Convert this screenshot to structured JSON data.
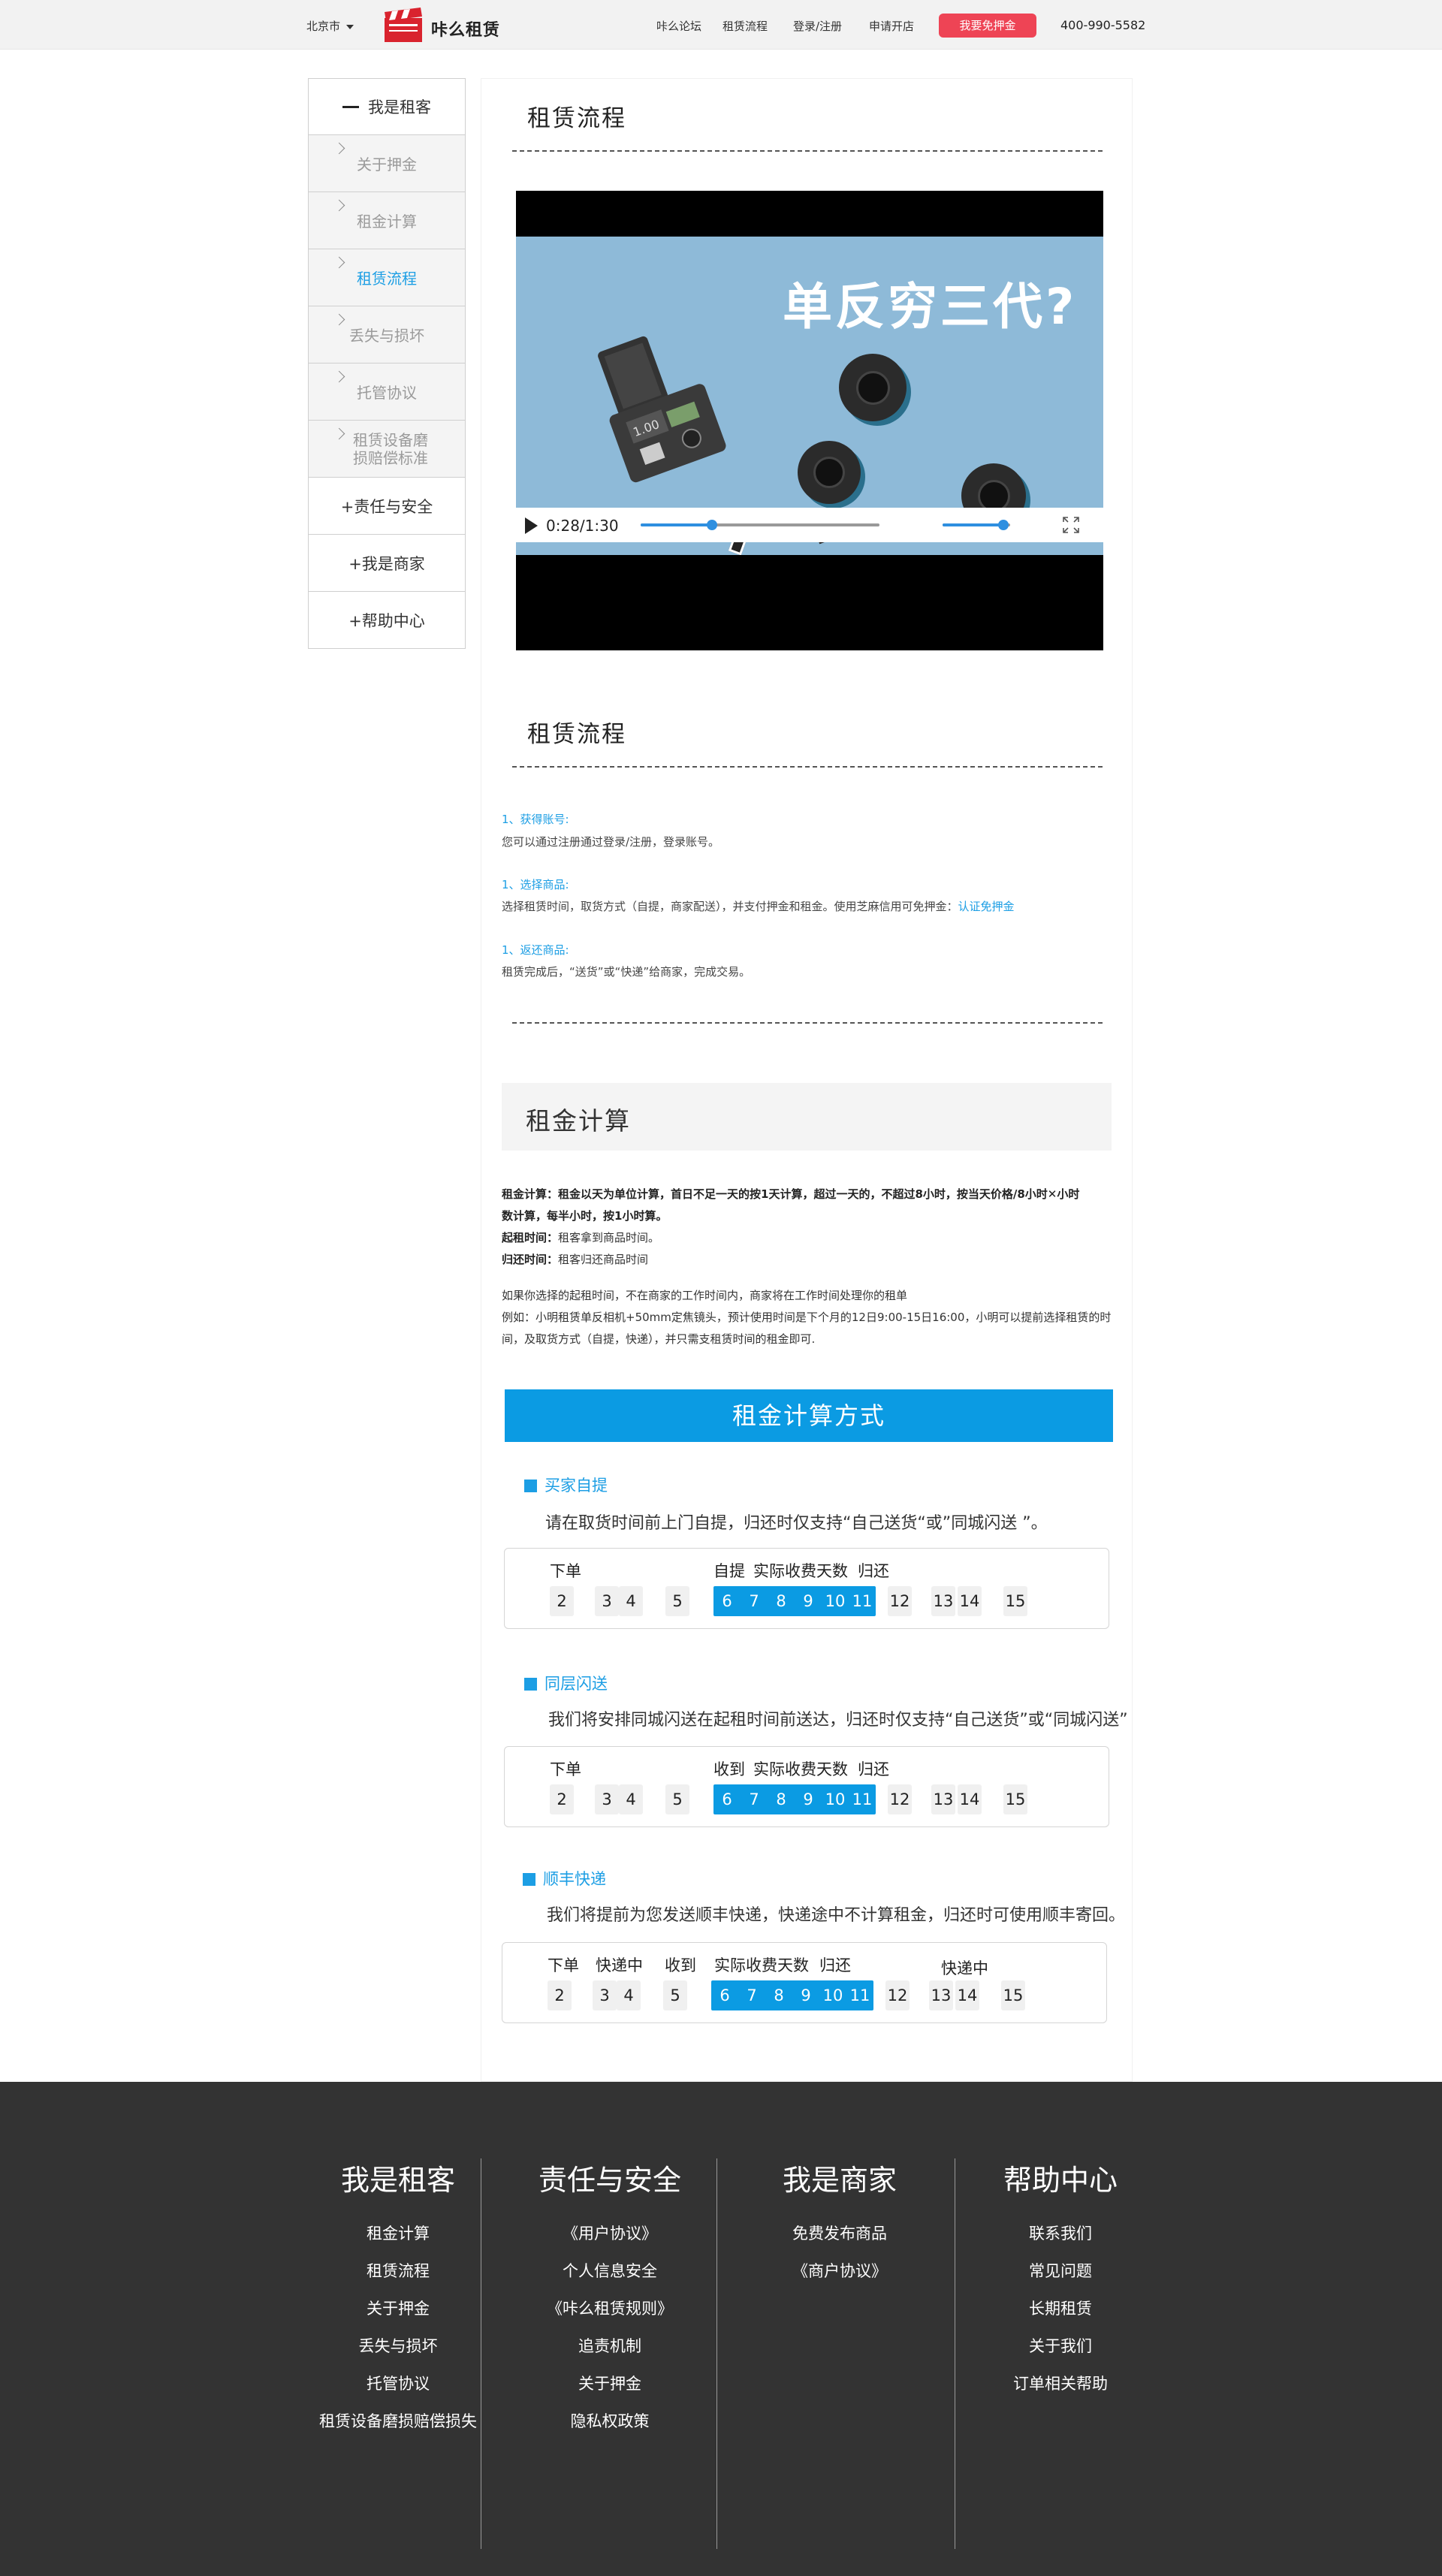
{
  "topbar": {
    "city": "北京市",
    "logo_text": "咔么租赁",
    "nav": [
      "咔么论坛",
      "租赁流程",
      "登录/注册",
      "申请开店"
    ],
    "cta": "我要免押金",
    "phone": "400-990-5582"
  },
  "sidebar": {
    "section_tenant": "我是租客",
    "sub_items": [
      "关于押金",
      "租金计算",
      "租赁流程",
      "丢失与损坏",
      "托管协议"
    ],
    "sub_item_long": [
      "租赁设备磨",
      "损赔偿标准"
    ],
    "section_safety": "+责任与安全",
    "section_merchant": "+我是商家",
    "section_help": "+帮助中心"
  },
  "main": {
    "title1": "租赁流程",
    "video": {
      "caption": "单反穷三代?",
      "time": "0:28/1:30",
      "progress": 0.3,
      "volume": 0.9
    },
    "title2": "租赁流程",
    "steps": [
      {
        "title": "1、获得账号:",
        "desc": "您可以通过注册通过登录/注册，登录账号。"
      },
      {
        "title": "1、选择商品:",
        "desc": "选择租赁时间，取货方式（自提，商家配送），并支付押金和租金。使用芝麻信用可免押金：",
        "link": "认证免押金"
      },
      {
        "title": "1、返还商品:",
        "desc": "租赁完成后，“送货”或“快递”给商家，完成交易。"
      }
    ],
    "rent_calc": {
      "title": "租金计算",
      "rule_label": "租金计算：",
      "rule_text": "租金以天为单位计算，首日不足一天的按1天计算，超过一天的，不超过8小时，按当天价格/8小时✕小时",
      "rule_text2": "数计算，每半小时，按1小时算。",
      "start_label": "起租时间：",
      "start_text": "租客拿到商品时间。",
      "return_label": "归还时间：",
      "return_text": "租客归还商品时间",
      "note1": "如果你选择的起租时间，不在商家的工作时间内，商家将在工作时间处理你的租单",
      "note2": "例如：小明租赁单反相机+50mm定焦镜头，预计使用时间是下个月的12日9:00-15日16:00，小明可以提前选择租赁的时",
      "note3": "间，及取货方式（自提，快递），并只需支租赁时间的租金即可."
    },
    "calc_method_title": "租金计算方式",
    "methods": [
      {
        "name": "买家自提",
        "desc": "请在取货时间前上门自提，归还时仅支持“自己送货“或”同城闪送 ”。",
        "labels": [
          "下单",
          "自提",
          "实际收费天数",
          "归还"
        ],
        "before": [
          "2",
          "3",
          "4",
          "5"
        ],
        "highlight": [
          "6",
          "7",
          "8",
          "9",
          "10",
          "11"
        ],
        "after": [
          "12",
          "13",
          "14",
          "15"
        ]
      },
      {
        "name": "同层闪送",
        "desc": "我们将安排同城闪送在起租时间前送达，归还时仅支持“自己送货”或“同城闪送”",
        "labels": [
          "下单",
          "收到",
          "实际收费天数",
          "归还"
        ],
        "before": [
          "2",
          "3",
          "4",
          "5"
        ],
        "highlight": [
          "6",
          "7",
          "8",
          "9",
          "10",
          "11"
        ],
        "after": [
          "12",
          "13",
          "14",
          "15"
        ]
      },
      {
        "name": "顺丰快递",
        "desc": "我们将提前为您发送顺丰快递，快递途中不计算租金，归还时可使用顺丰寄回。",
        "labels": [
          "下单",
          "快递中",
          "收到",
          "实际收费天数",
          "归还",
          "快递中"
        ],
        "before": [
          "2",
          "3",
          "4",
          "5"
        ],
        "highlight": [
          "6",
          "7",
          "8",
          "9",
          "10",
          "11"
        ],
        "after": [
          "12",
          "13",
          "14",
          "15"
        ]
      }
    ]
  },
  "footer": {
    "cols": [
      {
        "title": "我是租客",
        "items": [
          "租金计算",
          "租赁流程",
          "关于押金",
          "丢失与损坏",
          "托管协议",
          "租赁设备磨损赔偿损失"
        ]
      },
      {
        "title": "责任与安全",
        "items": [
          "《用户协议》",
          "个人信息安全",
          "《咔么租赁规则》",
          "追责机制",
          "关于押金",
          "隐私权政策"
        ]
      },
      {
        "title": "我是商家",
        "items": [
          "免费发布商品",
          "《商户协议》"
        ]
      },
      {
        "title": "帮助中心",
        "items": [
          "联系我们",
          "常见问题",
          "长期租赁",
          "关于我们",
          "订单相关帮助"
        ]
      }
    ]
  },
  "colors": {
    "accent": "#0b9be3",
    "cta": "#ee4455",
    "footer_bg": "#333333"
  }
}
